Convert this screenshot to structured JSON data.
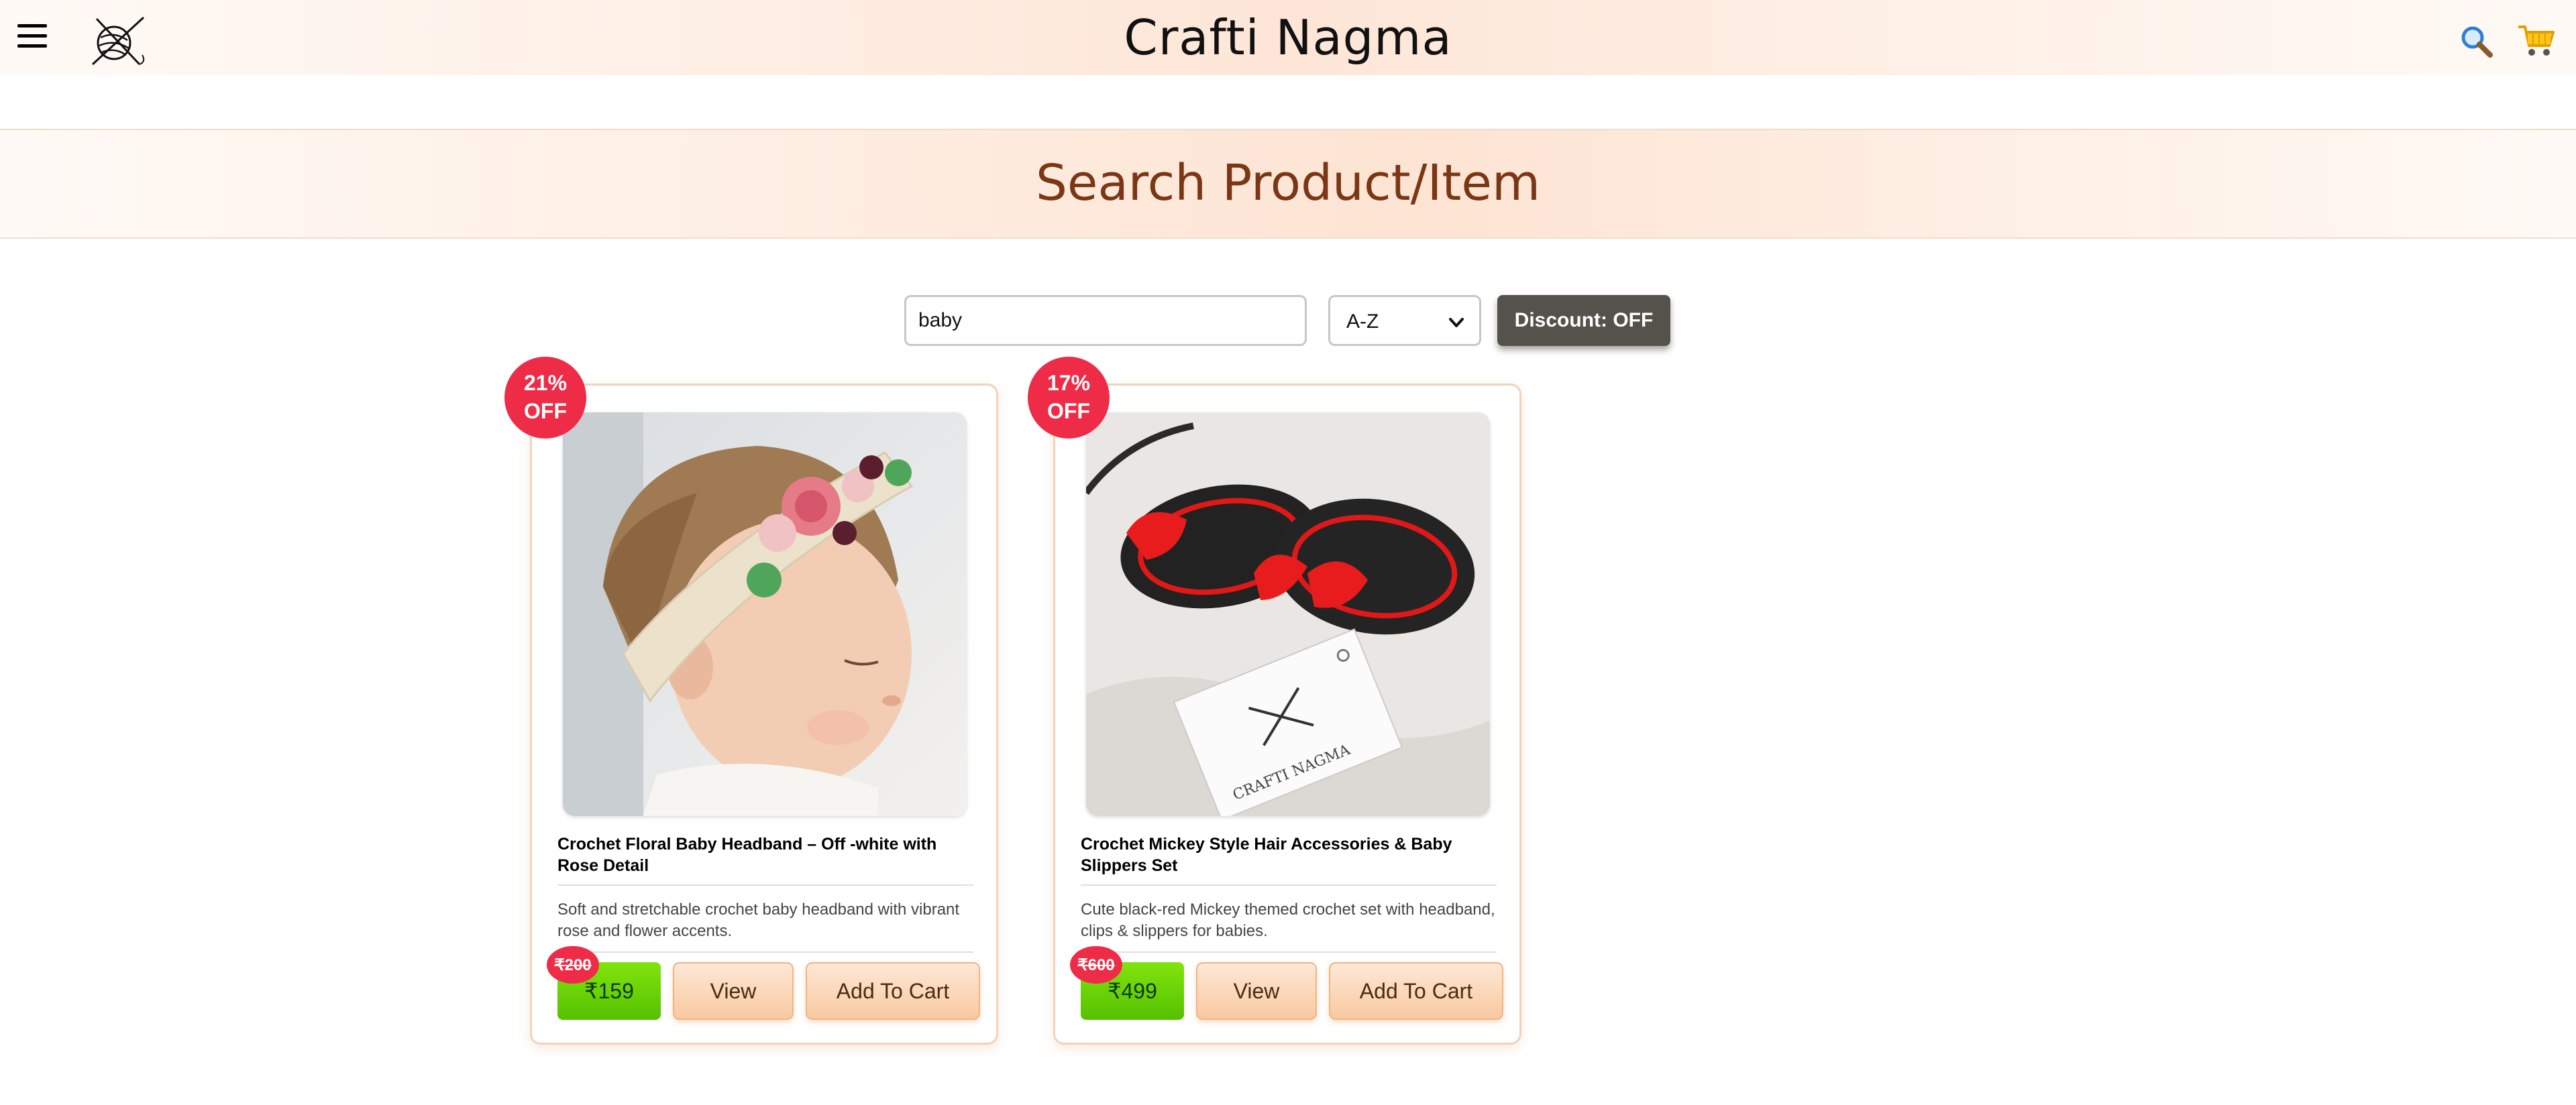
{
  "header": {
    "brand": "Crafti Nagma",
    "menu_icon": "hamburger-menu-icon",
    "logo_icon": "yarn-needles-logo",
    "search_icon": "magnifier-icon",
    "cart_icon": "shopping-cart-icon"
  },
  "page": {
    "heading": "Search Product/Item"
  },
  "filters": {
    "search_value": "baby",
    "sort_selected": "A-Z",
    "discount_label": "Discount: OFF"
  },
  "colors": {
    "accent_red": "#ee2c47",
    "price_green": "#5cc705",
    "heading_brown": "#7a3615",
    "discount_button": "#55524c"
  },
  "products": [
    {
      "discount_line1": "21%",
      "discount_line2": "OFF",
      "title": "Crochet Floral Baby Headband – Off -white with Rose Detail",
      "description": "Soft and stretchable crochet baby headband with vibrant rose and flower accents.",
      "old_price": "₹200",
      "price": "₹159",
      "view_label": "View",
      "cart_label": "Add To Cart"
    },
    {
      "discount_line1": "17%",
      "discount_line2": "OFF",
      "title": "Crochet Mickey Style Hair Accessories & Baby Slippers Set",
      "description": "Cute black-red Mickey themed crochet set with headband, clips & slippers for babies.",
      "old_price": "₹600",
      "price": "₹499",
      "view_label": "View",
      "cart_label": "Add To Cart"
    }
  ]
}
